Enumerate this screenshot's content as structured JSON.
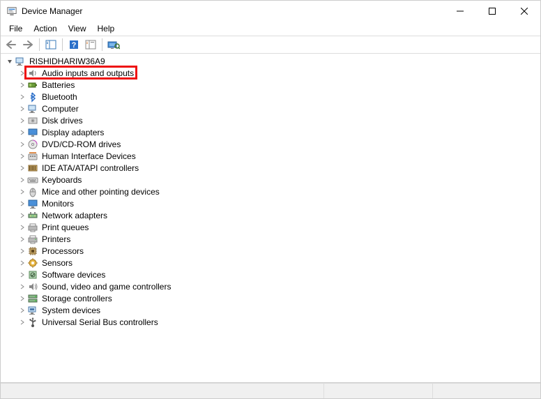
{
  "window": {
    "title": "Device Manager"
  },
  "menu": {
    "file": "File",
    "action": "Action",
    "view": "View",
    "help": "Help"
  },
  "toolbar": {
    "back": "Back",
    "forward": "Forward",
    "show_hide": "Show/Hide Console Tree",
    "help": "Help",
    "properties": "Properties",
    "scan": "Scan for hardware changes"
  },
  "tree": {
    "root": "RISHIDHARIW36A9",
    "items": [
      {
        "icon": "speaker",
        "label": "Audio inputs and outputs",
        "highlighted": true
      },
      {
        "icon": "battery",
        "label": "Batteries"
      },
      {
        "icon": "bluetooth",
        "label": "Bluetooth"
      },
      {
        "icon": "computer",
        "label": "Computer"
      },
      {
        "icon": "disk",
        "label": "Disk drives"
      },
      {
        "icon": "display",
        "label": "Display adapters"
      },
      {
        "icon": "dvd",
        "label": "DVD/CD-ROM drives"
      },
      {
        "icon": "hid",
        "label": "Human Interface Devices"
      },
      {
        "icon": "ide",
        "label": "IDE ATA/ATAPI controllers"
      },
      {
        "icon": "keyboard",
        "label": "Keyboards"
      },
      {
        "icon": "mouse",
        "label": "Mice and other pointing devices"
      },
      {
        "icon": "monitor",
        "label": "Monitors"
      },
      {
        "icon": "network",
        "label": "Network adapters"
      },
      {
        "icon": "printqueue",
        "label": "Print queues"
      },
      {
        "icon": "printer",
        "label": "Printers"
      },
      {
        "icon": "processor",
        "label": "Processors"
      },
      {
        "icon": "sensor",
        "label": "Sensors"
      },
      {
        "icon": "software",
        "label": "Software devices"
      },
      {
        "icon": "sound",
        "label": "Sound, video and game controllers"
      },
      {
        "icon": "storage",
        "label": "Storage controllers"
      },
      {
        "icon": "system",
        "label": "System devices"
      },
      {
        "icon": "usb",
        "label": "Universal Serial Bus controllers"
      }
    ]
  }
}
